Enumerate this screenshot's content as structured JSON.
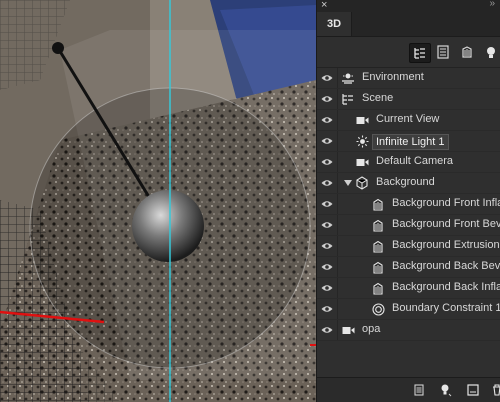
{
  "panel": {
    "close_glyph": "×",
    "collapse_glyph": "»",
    "tab_label": "3D"
  },
  "toolbar": {
    "icons": [
      "whole-scene-filter-icon",
      "meshes-filter-icon",
      "materials-filter-icon",
      "lights-filter-icon"
    ]
  },
  "layers": [
    {
      "label": "Environment",
      "icon": "environment-icon",
      "indent": 0,
      "visible": true
    },
    {
      "label": "Scene",
      "icon": "scene-icon",
      "indent": 0,
      "visible": true
    },
    {
      "label": "Current View",
      "icon": "camera-icon",
      "indent": 1,
      "visible": true
    },
    {
      "label": "Infinite Light 1",
      "icon": "light-icon",
      "indent": 1,
      "visible": true,
      "selected": true
    },
    {
      "label": "Default Camera",
      "icon": "camera-icon",
      "indent": 1,
      "visible": true
    },
    {
      "label": "Background",
      "icon": "mesh-icon",
      "indent": 0,
      "visible": true,
      "expanded": true
    },
    {
      "label": "Background Front Infla",
      "icon": "material-icon",
      "indent": 2,
      "visible": true
    },
    {
      "label": "Background Front Beve",
      "icon": "material-icon",
      "indent": 2,
      "visible": true
    },
    {
      "label": "Background Extrusion",
      "icon": "material-icon",
      "indent": 2,
      "visible": true
    },
    {
      "label": "Background Back Beve",
      "icon": "material-icon",
      "indent": 2,
      "visible": true
    },
    {
      "label": "Background Back Infla",
      "icon": "material-icon",
      "indent": 2,
      "visible": true
    },
    {
      "label": "Boundary Constraint 1",
      "icon": "constraint-icon",
      "indent": 2,
      "visible": true
    },
    {
      "label": "opa",
      "icon": "camera-icon",
      "indent": 0,
      "visible": true
    }
  ],
  "bottom_bar": {
    "icons": [
      "render-mesh-icon",
      "add-light-icon",
      "new-object-icon",
      "delete-icon"
    ]
  },
  "colors": {
    "panel_bg": "#2f2f2f",
    "selected_row": "#3e3e3e",
    "guide_cyan": "#36c8d8",
    "axis_red": "#e01010"
  }
}
